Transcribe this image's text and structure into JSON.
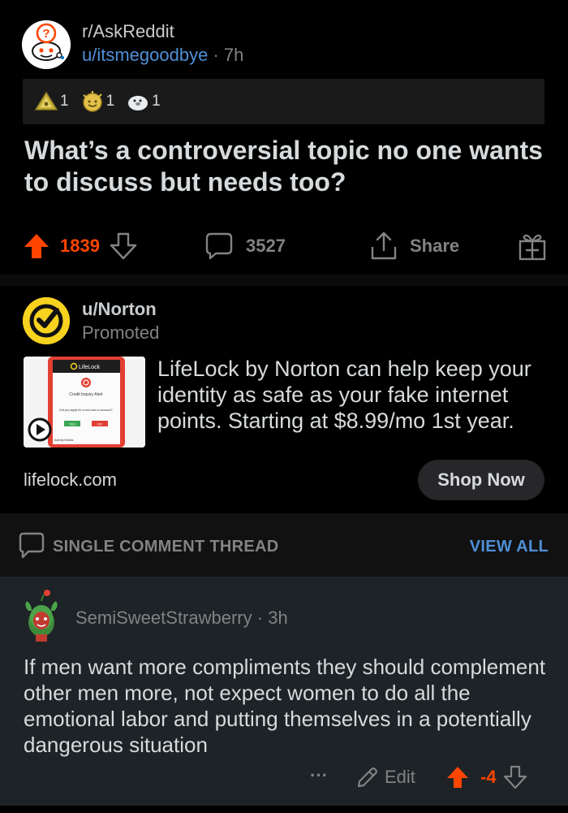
{
  "post": {
    "subreddit": "r/AskReddit",
    "author": "u/itsmegoodbye",
    "separator": " · ",
    "age": "7h",
    "awards": [
      {
        "icon": "helpful-award-icon",
        "count": "1"
      },
      {
        "icon": "wholesome-award-icon",
        "count": "1"
      },
      {
        "icon": "seal-award-icon",
        "count": "1"
      }
    ],
    "title": "What’s a controversial topic no one wants to discuss but needs too?",
    "upvotes": "1839",
    "comments": "3527",
    "share_label": "Share"
  },
  "ad": {
    "user": "u/Norton",
    "promoted_label": "Promoted",
    "thumb_brand": "LifeLock",
    "thumb_heading": "Credit Inquiry Alert",
    "thumb_question": "Did you apply for a new loan or account?",
    "thumb_yes": "YES",
    "thumb_no": "NO",
    "thumb_footer": "Activity Details",
    "text": "LifeLock by Norton can help keep your identity as safe as your fake internet points. Starting at $8.99/mo 1st year.",
    "domain": "lifelock.com",
    "cta": "Shop Now"
  },
  "thread": {
    "label": "SINGLE COMMENT THREAD",
    "view_all": "VIEW ALL"
  },
  "comment": {
    "author": "SemiSweetStrawberry",
    "separator": " · ",
    "age": "3h",
    "body": "If men want more compliments they should complement other men more, not expect women to do all the emotional labor and putting themselves in a potentially dangerous situation",
    "more": "···",
    "edit_label": "Edit",
    "score": "-4"
  },
  "colors": {
    "upvote": "#ff4500",
    "link": "#4f8fd6",
    "norton_yellow": "#f7d21f",
    "comment_bg": "#1d2326"
  }
}
